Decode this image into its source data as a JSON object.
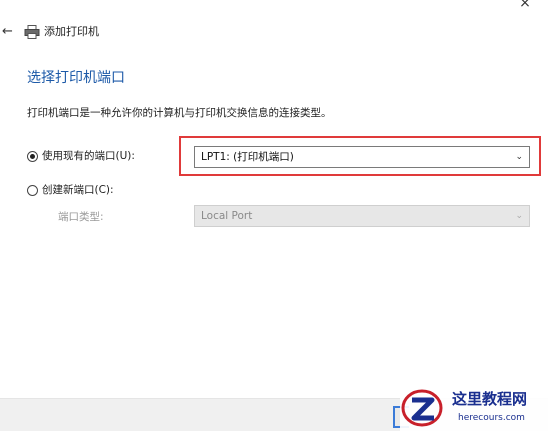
{
  "window": {
    "title": "添加打印机",
    "close_glyph": "×"
  },
  "page": {
    "heading": "选择打印机端口",
    "description": "打印机端口是一种允许你的计算机与打印机交换信息的连接类型。"
  },
  "options": {
    "use_existing_label": "使用现有的端口(U):",
    "use_existing_value": "LPT1: (打印机端口)",
    "create_new_label": "创建新端口(C):",
    "port_type_label": "端口类型:",
    "port_type_value": "Local Port"
  },
  "watermark": {
    "title": "这里教程网",
    "url": "herecours.com"
  },
  "colors": {
    "heading": "#1d5aa8",
    "highlight": "#e03a3a",
    "watermark": "#1a2f8f"
  }
}
